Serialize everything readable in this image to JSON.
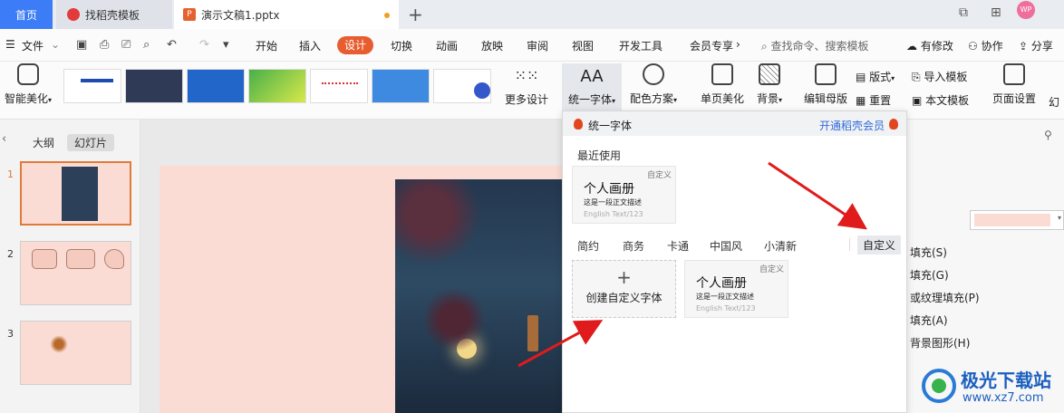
{
  "tabs": {
    "home": "首页",
    "templates": "找稻壳模板",
    "document": "演示文稿1.pptx"
  },
  "avatar_text": "WP",
  "menu": {
    "file": "文件",
    "items": [
      "开始",
      "插入",
      "设计",
      "切换",
      "动画",
      "放映",
      "审阅",
      "视图",
      "开发工具",
      "会员专享"
    ],
    "active": "设计",
    "search": "查找命令、搜索模板",
    "modified": "有修改",
    "collab": "协作",
    "share": "分享"
  },
  "ribbon": {
    "smart_beautify": "智能美化",
    "more_designs": "更多设计",
    "unify_font": "统一字体",
    "color_scheme": "配色方案",
    "single_page": "单页美化",
    "background": "背景",
    "edit_master": "编辑母版",
    "layout": "版式",
    "reset": "重置",
    "import_template": "导入模板",
    "this_template": "本文模板",
    "page_setup": "页面设置",
    "slide_size": "幻"
  },
  "left_panel": {
    "outline": "大纲",
    "slides": "幻灯片",
    "slide_numbers": [
      "1",
      "2",
      "3"
    ]
  },
  "right_panel": {
    "items": [
      "填充(S)",
      "填充(G)",
      "或纹理填充(P)",
      "填充(A)",
      "背景图形(H)"
    ]
  },
  "popup": {
    "title": "统一字体",
    "member_link": "开通稻壳会员",
    "recent": "最近使用",
    "card_tag": "自定义",
    "card_title": "个人画册",
    "card_desc": "这是一段正文描述",
    "card_en": "English Text/123",
    "categories": [
      "简约",
      "商务",
      "卡通",
      "中国风",
      "小清新"
    ],
    "custom_category": "自定义",
    "create_custom": "创建自定义字体"
  },
  "watermark": {
    "title": "极光下载站",
    "url": "www.xz7.com"
  },
  "colors": {
    "accent": "#e85d2f",
    "home_tab": "#3c7cf6",
    "slide_bg": "#fbdcd5",
    "arrow": "#e01b1b",
    "link": "#2f6bd8"
  }
}
